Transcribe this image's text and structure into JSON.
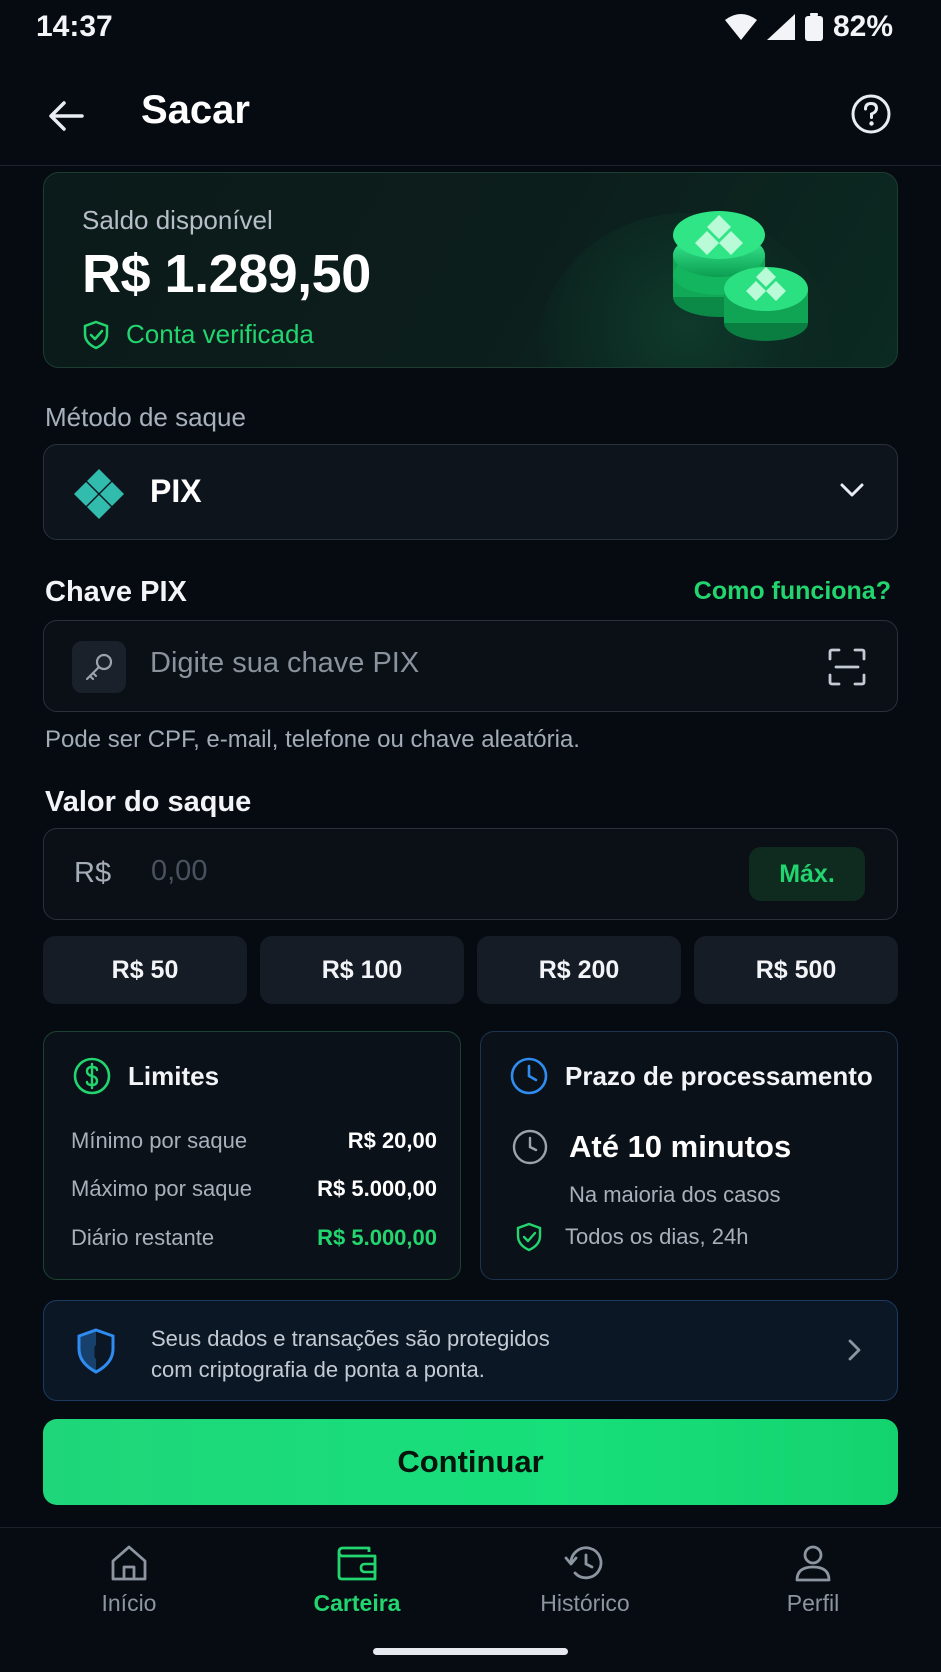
{
  "status_bar": {
    "time": "14:37",
    "battery": "82%"
  },
  "header": {
    "title": "Sacar"
  },
  "balance": {
    "label": "Saldo disponível",
    "value": "R$ 1.289,50",
    "verified": "Conta verificada"
  },
  "method": {
    "label": "Método de saque",
    "value": "PIX"
  },
  "pix_key": {
    "label": "Chave PIX",
    "help_link": "Como funciona?",
    "placeholder": "Digite sua chave PIX",
    "helper": "Pode ser CPF, e-mail, telefone ou chave aleatória."
  },
  "amount": {
    "label": "Valor do saque",
    "currency": "R$",
    "placeholder": "0,00",
    "max_label": "Máx.",
    "quick": [
      "R$ 50",
      "R$ 100",
      "R$ 200",
      "R$ 500"
    ]
  },
  "limits": {
    "title": "Limites",
    "rows": [
      {
        "key": "Mínimo por saque",
        "value": "R$ 20,00"
      },
      {
        "key": "Máximo por saque",
        "value": "R$ 5.000,00"
      },
      {
        "key": "Diário restante",
        "value": "R$ 5.000,00"
      }
    ]
  },
  "processing": {
    "title": "Prazo de processamento",
    "main": "Até 10 minutos",
    "sub": "Na maioria dos casos",
    "days": "Todos os dias, 24h"
  },
  "security": {
    "line1": "Seus dados e transações são protegidos",
    "line2": "com criptografia de ponta a ponta."
  },
  "continue_label": "Continuar",
  "nav": [
    {
      "label": "Início",
      "icon": "home-icon"
    },
    {
      "label": "Carteira",
      "icon": "wallet-icon",
      "active": true
    },
    {
      "label": "Histórico",
      "icon": "history-icon"
    },
    {
      "label": "Perfil",
      "icon": "profile-icon"
    }
  ],
  "colors": {
    "accent": "#22d56f",
    "background": "#060b12",
    "info_blue": "#2f8cf0"
  }
}
